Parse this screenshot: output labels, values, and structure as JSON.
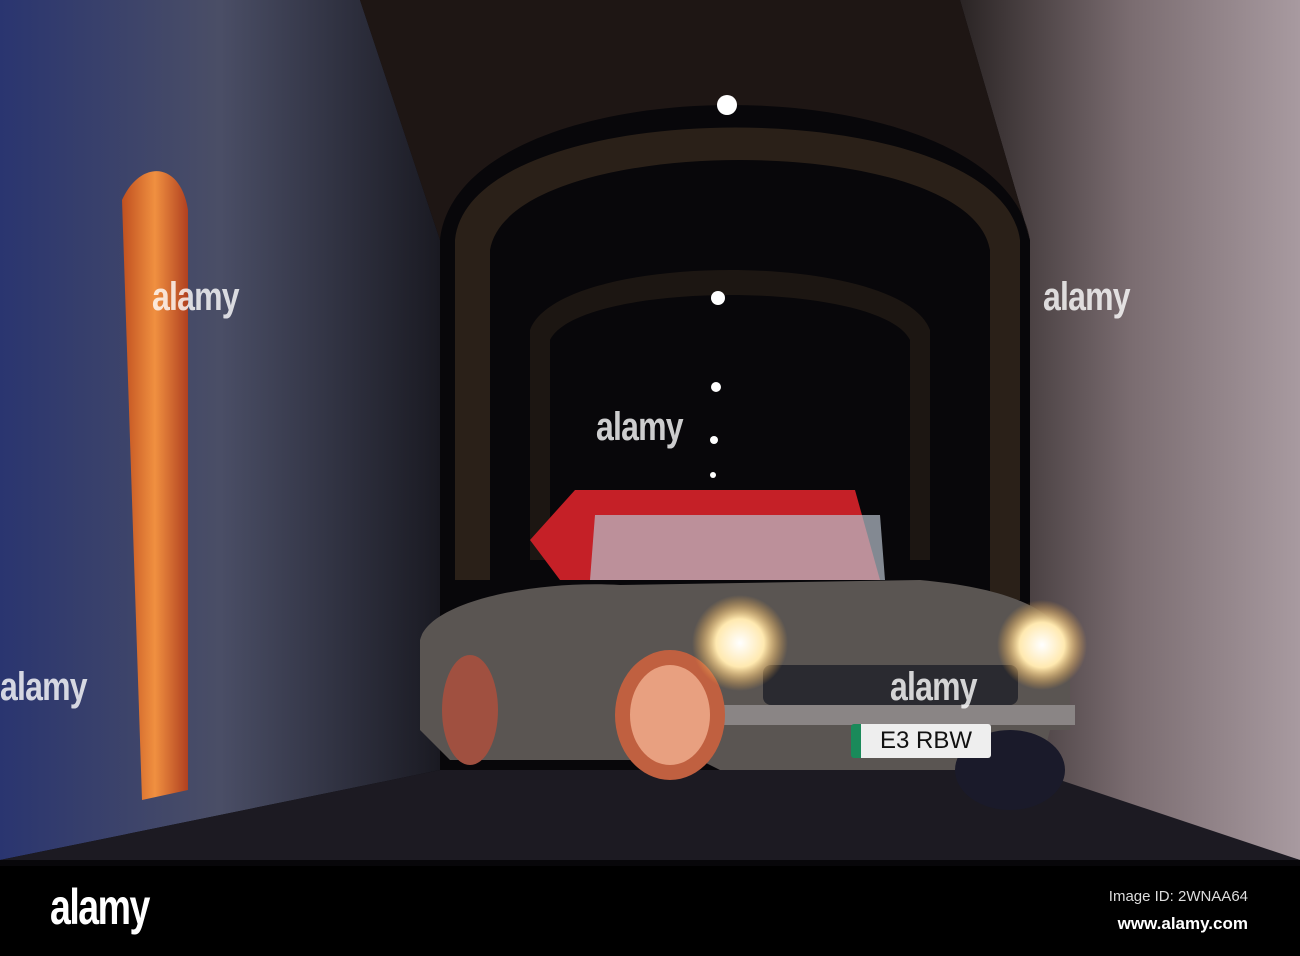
{
  "photo": {
    "subject": "classic roadster in tunnel",
    "number_plate": "E3 RBW",
    "watermark": "alamy"
  },
  "footer": {
    "logo": "alamy",
    "image_id": "Image ID: 2WNAA64",
    "url": "www.alamy.com"
  }
}
